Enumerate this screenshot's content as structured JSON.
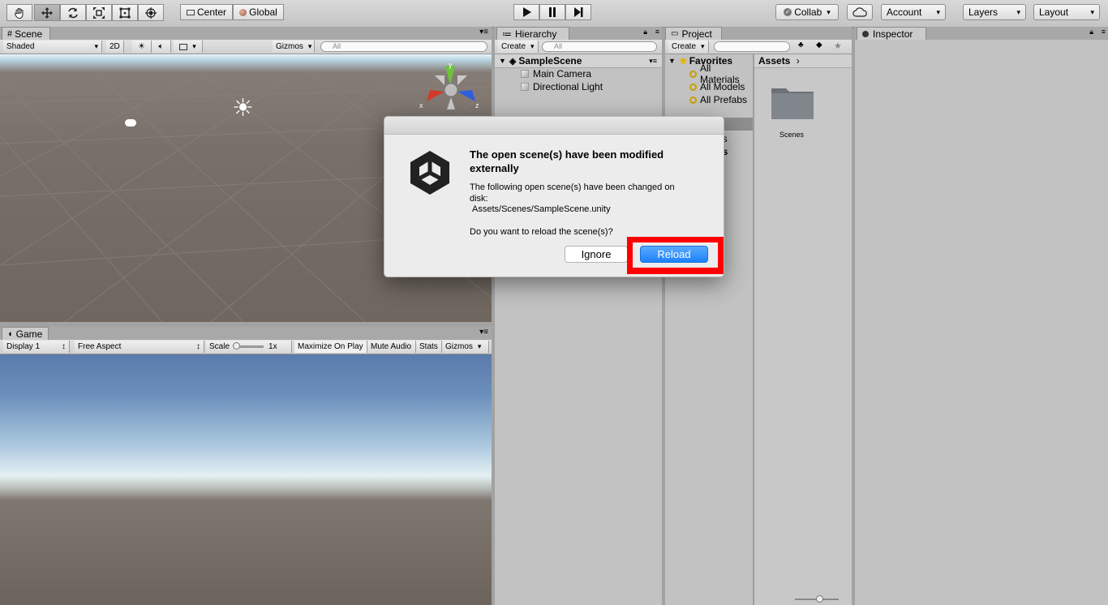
{
  "toolbar": {
    "tools": [
      "hand-icon",
      "move-icon",
      "rotate-icon",
      "scale-icon",
      "rect-icon",
      "transform-icon"
    ],
    "center_label": "Center",
    "global_label": "Global",
    "collab_label": "Collab",
    "account_label": "Account",
    "layers_label": "Layers",
    "layout_label": "Layout"
  },
  "scene": {
    "tab_label": "Scene",
    "shading_label": "Shaded",
    "mode_2d_label": "2D",
    "gizmos_label": "Gizmos",
    "search_placeholder": "All",
    "axis_y": "y",
    "axis_x": "x",
    "axis_z": "z"
  },
  "game": {
    "tab_label": "Game",
    "display_label": "Display 1",
    "aspect_label": "Free Aspect",
    "scale_label": "Scale",
    "scale_value": "1x",
    "maximize_label": "Maximize On Play",
    "mute_label": "Mute Audio",
    "stats_label": "Stats",
    "gizmos_label": "Gizmos"
  },
  "hierarchy": {
    "tab_label": "Hierarchy",
    "create_label": "Create",
    "search_placeholder": "All",
    "scene_name": "SampleScene",
    "items": [
      "Main Camera",
      "Directional Light"
    ]
  },
  "project": {
    "tab_label": "Project",
    "create_label": "Create",
    "favorites_label": "Favorites",
    "favorites": [
      "All Materials",
      "All Models",
      "All Prefabs"
    ],
    "hidden_rows": [
      "es",
      "es"
    ],
    "breadcrumb": "Assets",
    "folders": [
      "Scenes"
    ]
  },
  "inspector": {
    "tab_label": "Inspector"
  },
  "dialog": {
    "title": "The open scene(s) have been modified externally",
    "body_line1": "The following open scene(s) have been changed on disk:",
    "body_path": "Assets/Scenes/SampleScene.unity",
    "question": "Do you want to reload the scene(s)?",
    "ignore_label": "Ignore",
    "reload_label": "Reload",
    "highlight_color": "#ff0000",
    "primary_color": "#1a82fb"
  }
}
